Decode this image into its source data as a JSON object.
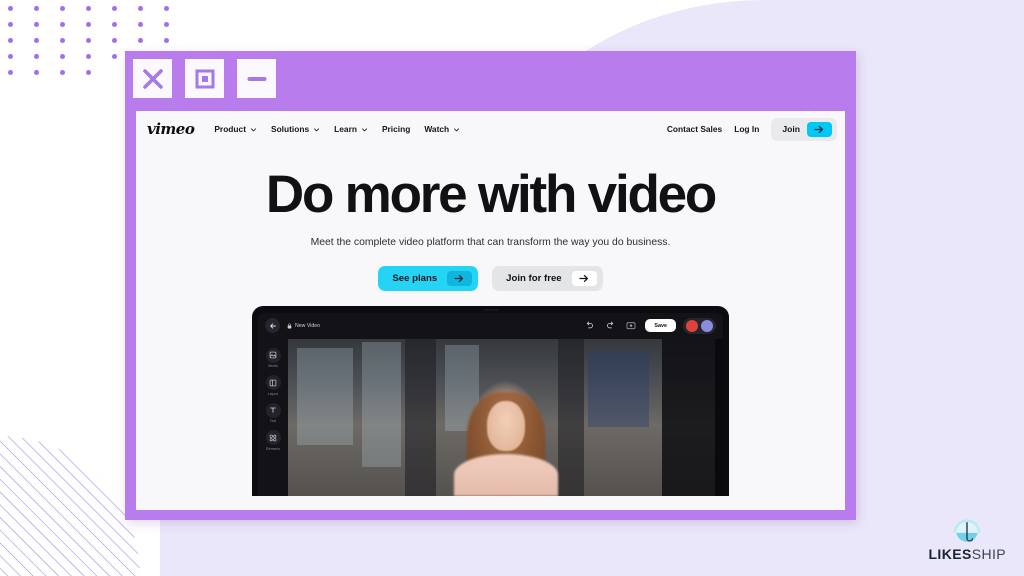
{
  "window_controls": [
    {
      "name": "close",
      "icon": "x-icon"
    },
    {
      "name": "maximize",
      "icon": "square-icon"
    },
    {
      "name": "minimize",
      "icon": "minus-icon"
    }
  ],
  "site": {
    "logo": "vimeo",
    "nav": [
      {
        "label": "Product",
        "has_dropdown": true
      },
      {
        "label": "Solutions",
        "has_dropdown": true
      },
      {
        "label": "Learn",
        "has_dropdown": true
      },
      {
        "label": "Pricing",
        "has_dropdown": false
      },
      {
        "label": "Watch",
        "has_dropdown": true
      }
    ],
    "nav_right": {
      "contact_sales": "Contact Sales",
      "log_in": "Log In",
      "join": "Join",
      "join_arrow_icon": "arrow-right-icon"
    }
  },
  "hero": {
    "heading": "Do more with video",
    "subheading": "Meet the complete video platform that can transform the way you do business.",
    "cta_primary": "See plans",
    "cta_secondary": "Join for free",
    "cta_arrow_icon": "arrow-right-icon"
  },
  "editor": {
    "back_icon": "arrow-left-icon",
    "lock_icon": "lock-icon",
    "project_title": "New Video",
    "undo_icon": "undo-icon",
    "redo_icon": "redo-icon",
    "display_icon": "monitor-icon",
    "save_label": "Save",
    "avatars": [
      {
        "name": "avatar-red",
        "color": "#e0413a"
      },
      {
        "name": "avatar-purple",
        "color": "#8b8ce0"
      }
    ],
    "tools": [
      {
        "icon": "media-icon",
        "label": "Media"
      },
      {
        "icon": "layout-icon",
        "label": "Layout"
      },
      {
        "icon": "text-icon",
        "label": "Text"
      },
      {
        "icon": "elements-icon",
        "label": "Elements"
      }
    ]
  },
  "brand": {
    "logo_name": "LIKESSHIP",
    "logo_bold": "LIKES",
    "logo_thin": "SHIP"
  },
  "colors": {
    "window_frame_purple": "#b87ced",
    "page_background": "#f8f8fa",
    "accent_cyan": "#25d4f5",
    "join_chip_cyan": "#00c8f4",
    "lavender_panel": "#ebe7fa",
    "dot_purple": "#9b72e8",
    "hatch_purple": "#8f86e0",
    "editor_dark": "#121217"
  }
}
